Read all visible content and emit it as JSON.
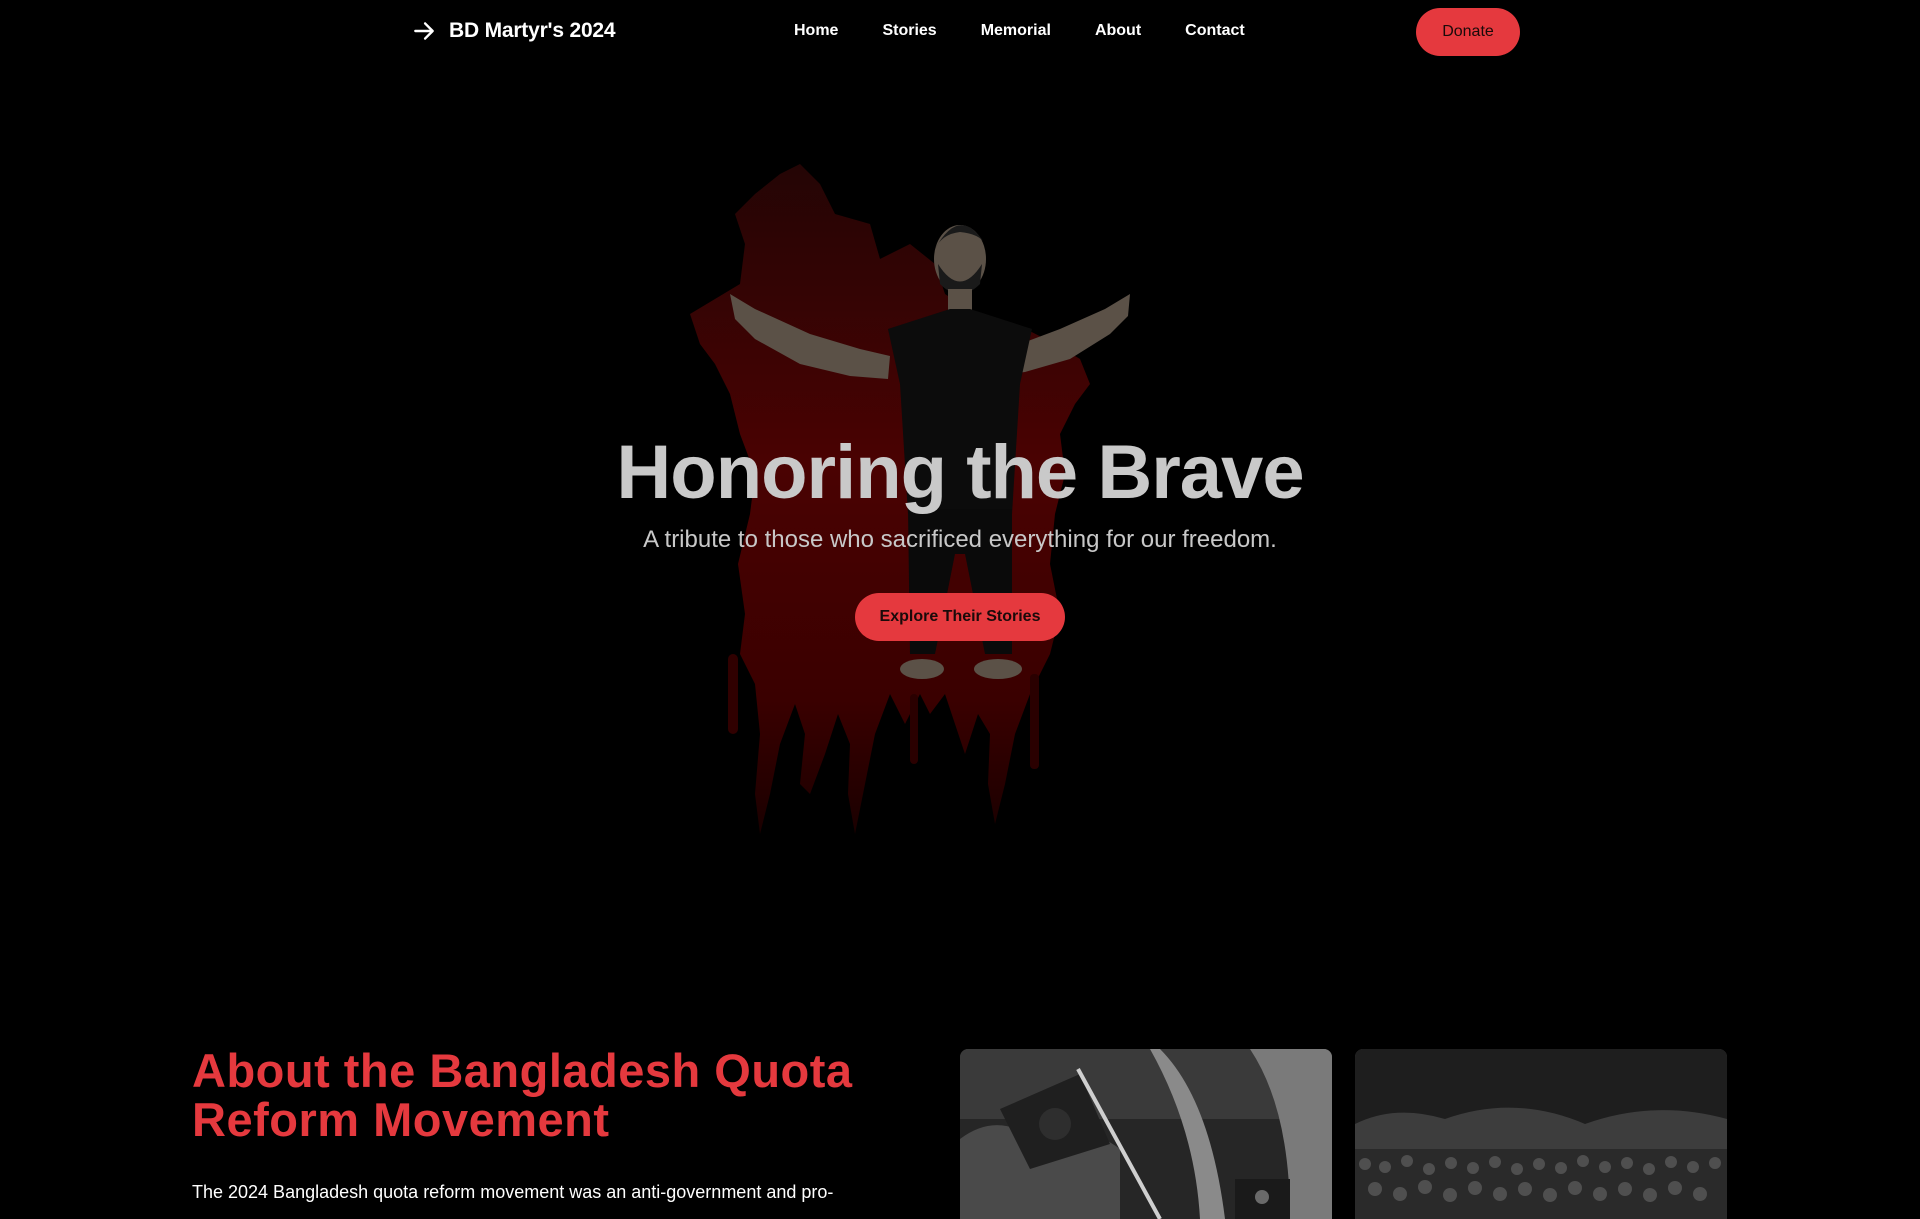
{
  "nav": {
    "brand": "BD Martyr's 2024",
    "links": [
      "Home",
      "Stories",
      "Memorial",
      "About",
      "Contact"
    ],
    "donate_label": "Donate"
  },
  "hero": {
    "title": "Honoring the Brave",
    "subtitle": "A tribute to those who sacrificed everything for our freedom.",
    "button_label": "Explore Their Stories"
  },
  "about": {
    "title": "About the Bangladesh Quota Reform Movement",
    "text": "The 2024 Bangladesh quota reform movement was an anti-government and pro-"
  },
  "colors": {
    "accent": "#e5393e",
    "background": "#000000",
    "blood": "#5a0000"
  },
  "icons": {
    "brand": "arrow-right-icon"
  }
}
